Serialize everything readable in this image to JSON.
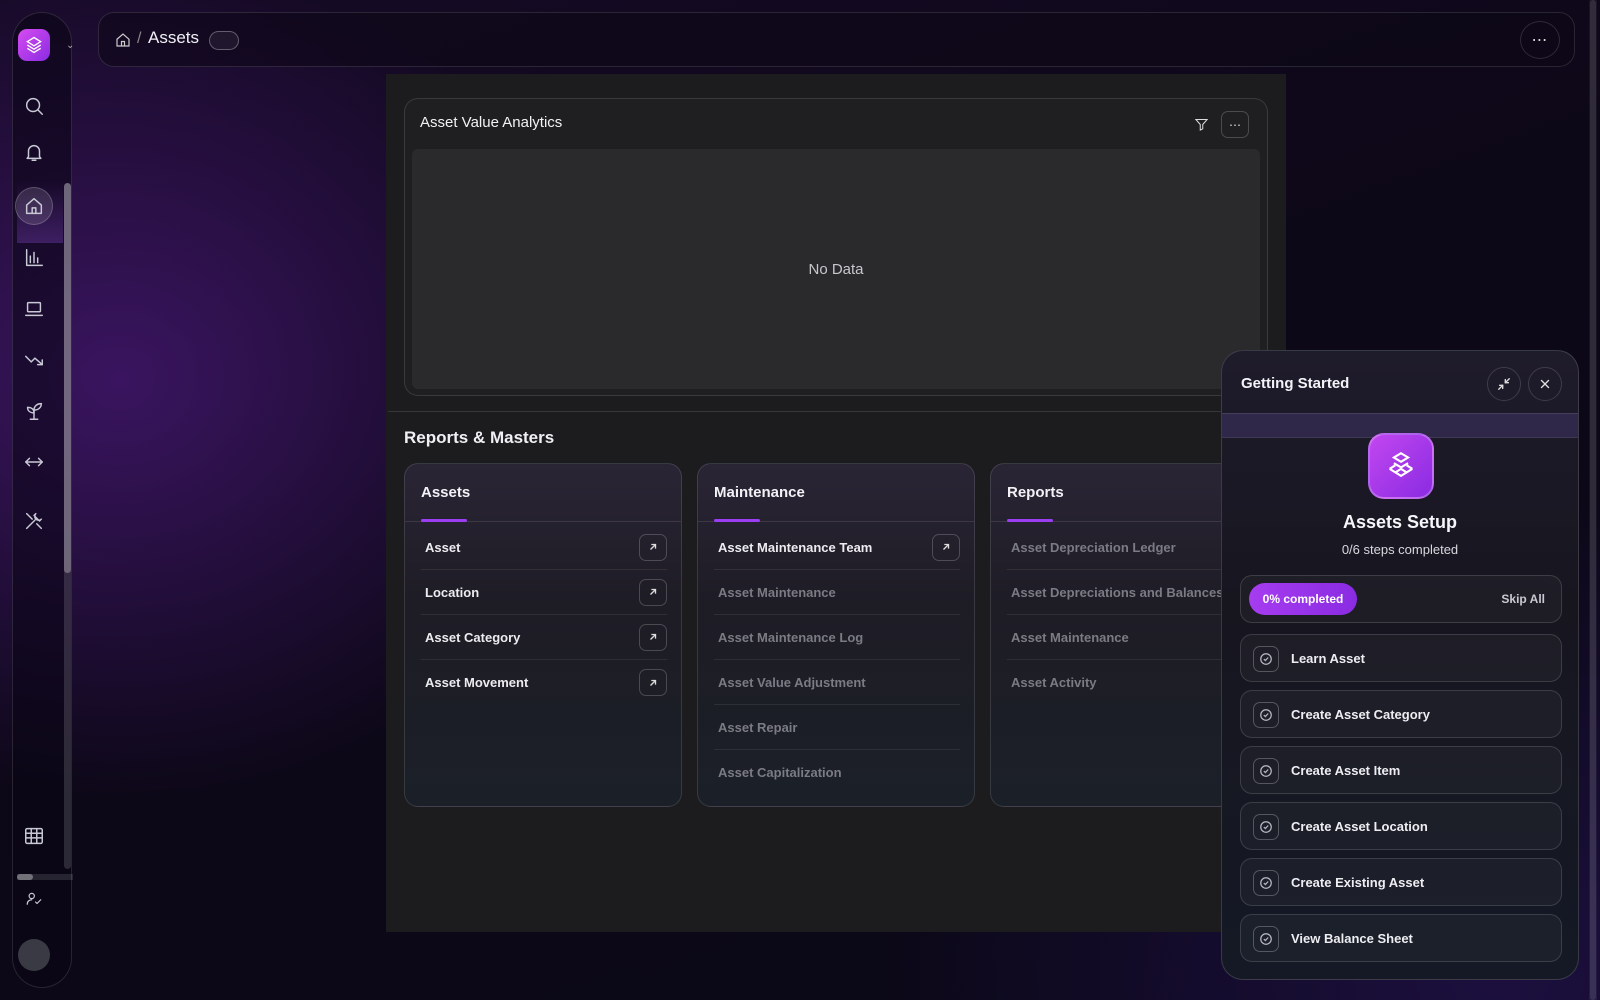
{
  "breadcrumb": {
    "title": "Assets"
  },
  "sidebar": {
    "icons": [
      "search-icon",
      "bell-icon",
      "home-icon",
      "bar-chart-icon",
      "laptop-icon",
      "trend-down-icon",
      "plant-icon",
      "arrows-horizontal-icon",
      "tools-icon",
      "table-icon",
      "user-check-icon"
    ]
  },
  "chart": {
    "title": "Asset Value Analytics",
    "empty_text": "No Data"
  },
  "reports": {
    "section_title": "Reports & Masters",
    "cards": [
      {
        "title": "Assets",
        "items": [
          {
            "label": "Asset",
            "enabled": true
          },
          {
            "label": "Location",
            "enabled": true
          },
          {
            "label": "Asset Category",
            "enabled": true
          },
          {
            "label": "Asset Movement",
            "enabled": true
          }
        ]
      },
      {
        "title": "Maintenance",
        "items": [
          {
            "label": "Asset Maintenance Team",
            "enabled": true
          },
          {
            "label": "Asset Maintenance",
            "enabled": false
          },
          {
            "label": "Asset Maintenance Log",
            "enabled": false
          },
          {
            "label": "Asset Value Adjustment",
            "enabled": false
          },
          {
            "label": "Asset Repair",
            "enabled": false
          },
          {
            "label": "Asset Capitalization",
            "enabled": false
          }
        ]
      },
      {
        "title": "Reports",
        "items": [
          {
            "label": "Asset Depreciation Ledger",
            "enabled": false
          },
          {
            "label": "Asset Depreciations and Balances",
            "enabled": false
          },
          {
            "label": "Asset Maintenance",
            "enabled": false
          },
          {
            "label": "Asset Activity",
            "enabled": false
          }
        ]
      }
    ]
  },
  "getting_started": {
    "title": "Getting Started",
    "setup_title": "Assets Setup",
    "steps_text": "0/6 steps completed",
    "progress_label": "0% completed",
    "skip_label": "Skip All",
    "progress": 0,
    "tasks": [
      "Learn Asset",
      "Create Asset Category",
      "Create Asset Item",
      "Create Asset Location",
      "Create Existing Asset",
      "View Balance Sheet"
    ]
  },
  "colors": {
    "accent": "#9b3df0",
    "brand": "#c247f0"
  }
}
